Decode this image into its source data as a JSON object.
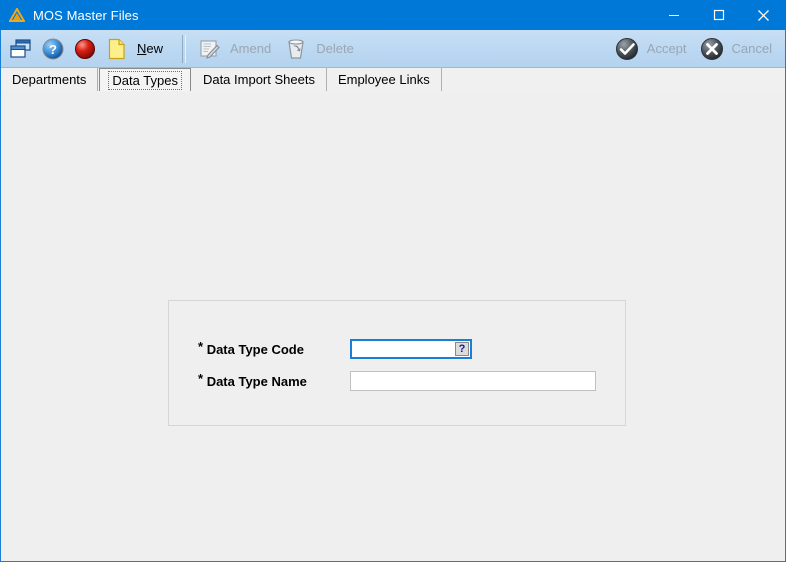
{
  "window": {
    "title": "MOS Master Files",
    "app_icon": "triangle-icon",
    "accent_color": "#0078d7",
    "toolbar_color": "#bcd8f2",
    "background_color": "#efefef"
  },
  "titlebar_buttons": [
    {
      "name": "minimize",
      "glyph": "minimize-icon"
    },
    {
      "name": "maximize",
      "glyph": "maximize-icon"
    },
    {
      "name": "close",
      "glyph": "close-icon"
    }
  ],
  "toolbar": {
    "items": [
      {
        "icon": "cascade-windows-icon",
        "label": "",
        "enabled": true
      },
      {
        "icon": "help-question-icon",
        "label": "",
        "enabled": true
      },
      {
        "icon": "red-sphere-stop-icon",
        "label": "",
        "enabled": true
      },
      {
        "icon": "yellow-page-icon",
        "label": "New",
        "accel": "N",
        "enabled": true
      },
      {
        "icon": "notepad-pencil-icon",
        "label": "Amend",
        "enabled": false
      },
      {
        "icon": "recycle-bin-icon",
        "label": "Delete",
        "enabled": false
      }
    ],
    "right_items": [
      {
        "icon": "accept-check-icon",
        "label": "Accept",
        "enabled": false
      },
      {
        "icon": "cancel-cross-icon",
        "label": "Cancel",
        "enabled": false
      }
    ],
    "new_label_before": "",
    "new_accel": "N",
    "new_label_after": "ew",
    "amend_label": "Amend",
    "delete_label": "Delete",
    "accept_label": "Accept",
    "cancel_label": "Cancel"
  },
  "tabs": [
    {
      "label": "Departments",
      "selected": false
    },
    {
      "label": "Data Types",
      "selected": true
    },
    {
      "label": "Data Import Sheets",
      "selected": false
    },
    {
      "label": "Employee Links",
      "selected": false
    }
  ],
  "form": {
    "fields": [
      {
        "label": "Data Type Code",
        "required_marker": "*",
        "value": "",
        "placeholder": "",
        "focused": true,
        "has_lookup": true,
        "lookup_glyph": "?"
      },
      {
        "label": "Data Type Name",
        "required_marker": "*",
        "value": "",
        "placeholder": "",
        "focused": false,
        "has_lookup": false
      }
    ]
  }
}
